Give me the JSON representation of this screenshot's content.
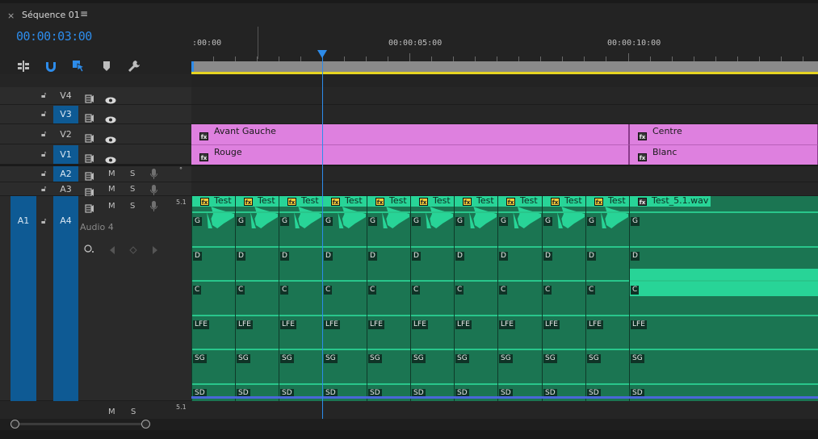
{
  "tab": {
    "close": "×",
    "title": "Séquence 01",
    "menu": "≡"
  },
  "timecode": "00:00:03:00",
  "ruler": {
    "labels": [
      ":00:00",
      "00:00:05:00",
      "00:00:10:00"
    ]
  },
  "tracks": {
    "video": [
      {
        "name": "V4",
        "selected": false
      },
      {
        "name": "V3",
        "selected": true
      },
      {
        "name": "V2",
        "selected": false
      },
      {
        "name": "V1",
        "selected": true
      }
    ],
    "audio": [
      {
        "name": "A2",
        "selected": true,
        "m": "M",
        "s": "S"
      },
      {
        "name": "A3",
        "selected": false,
        "m": "M",
        "s": "S"
      },
      {
        "name": "A4",
        "selected": true,
        "source": "A1",
        "m": "M",
        "s": "S",
        "label": "Audio 4"
      }
    ],
    "a4_channel_format": "5.1",
    "master_format": "5.1",
    "master": {
      "m": "M",
      "s": "S"
    }
  },
  "v2_clips": {
    "fx": "fx",
    "left": "Avant Gauche",
    "right": "Centre"
  },
  "v1_clips": {
    "fx": "fx",
    "left": "Rouge",
    "right": "Blanc"
  },
  "audio_clips": {
    "test_clip_name": "Test",
    "wav_clip_name": "Test_5.1.wav",
    "channels": [
      "G",
      "D",
      "C",
      "LFE",
      "SG",
      "SD"
    ],
    "fx": "fx"
  },
  "colors": {
    "accent": "#2d8ceb",
    "video_clip": "#de80df",
    "audio_clip": "#1b7552",
    "audio_highlight": "#28d497",
    "work_area": "#e6d422"
  }
}
